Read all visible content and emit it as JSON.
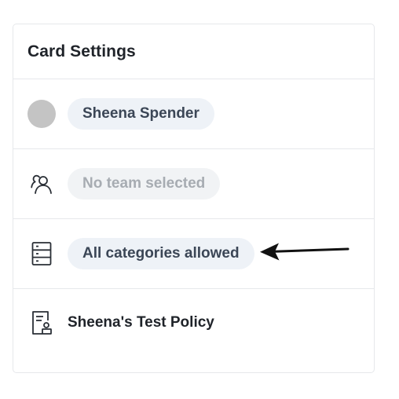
{
  "card": {
    "title": "Card Settings"
  },
  "rows": {
    "cardholder": {
      "label": "Sheena Spender"
    },
    "team": {
      "label": "No team selected"
    },
    "categories": {
      "label": "All categories allowed"
    },
    "policy": {
      "label": "Sheena's Test Policy"
    }
  },
  "icons": {
    "avatar": "avatar",
    "team": "team-icon",
    "categories": "categories-icon",
    "policy": "policy-document-icon",
    "annotation": "arrow-left-icon"
  },
  "colors": {
    "pill_background": "#eef2f7",
    "pill_text": "#3b4656",
    "muted_text": "#a7acb2",
    "avatar": "#c4c4c4"
  }
}
